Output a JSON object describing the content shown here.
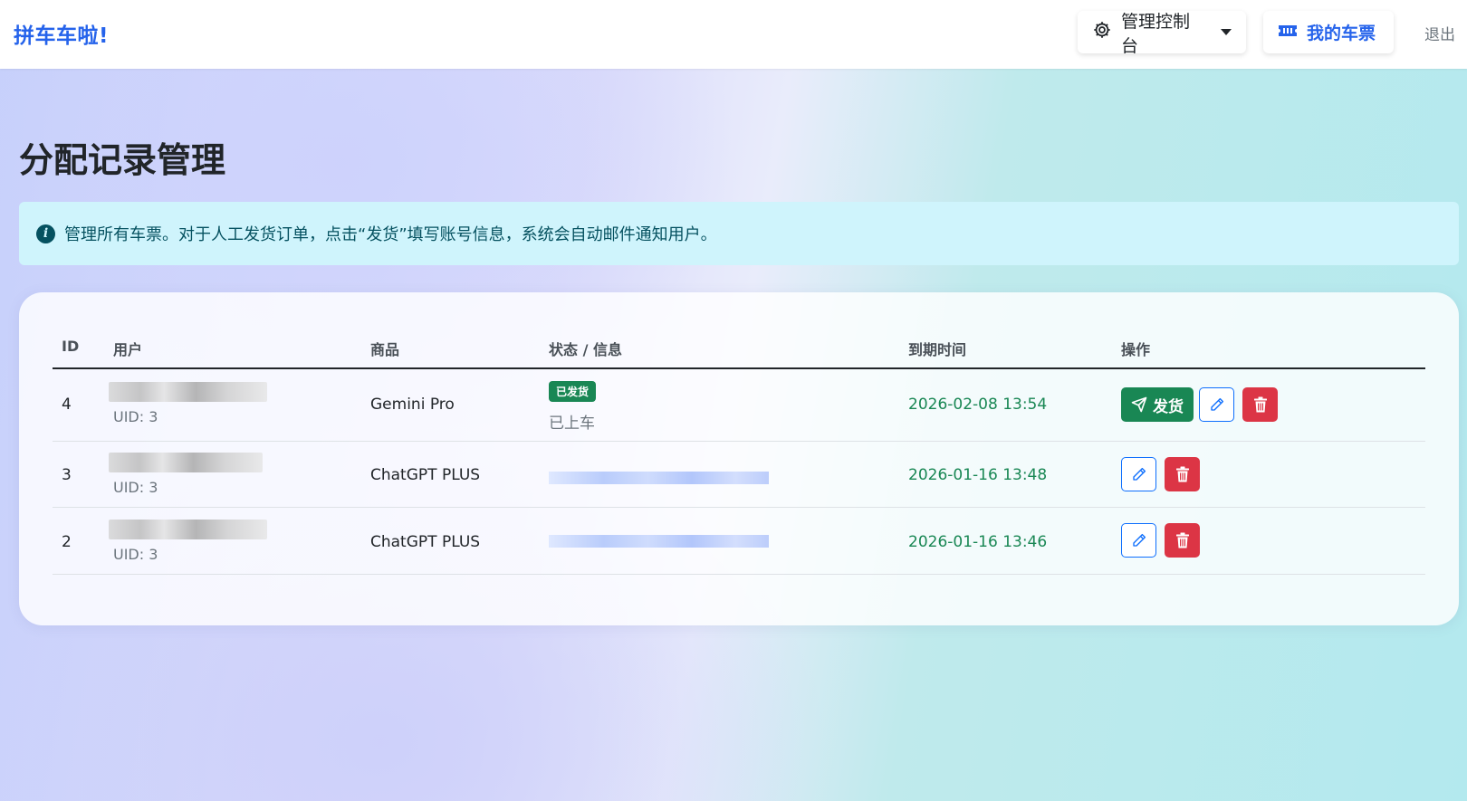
{
  "nav": {
    "brand": "拼车车啦!",
    "admin_label": "管理控制台",
    "tickets_label": "我的车票",
    "logout_label": "退出"
  },
  "page": {
    "title": "分配记录管理",
    "alert": "管理所有车票。对于人工发货订单，点击“发货”填写账号信息，系统会自动邮件通知用户。"
  },
  "table": {
    "headers": {
      "id": "ID",
      "user": "用户",
      "product": "商品",
      "status": "状态 / 信息",
      "expiry": "到期时间",
      "actions": "操作"
    },
    "rows": [
      {
        "id": "4",
        "uid": "UID: 3",
        "product": "Gemini Pro",
        "status_badge": "已发货",
        "status_note": "已上车",
        "expiry": "2026-02-08 13:54",
        "ship_label": "发货"
      },
      {
        "id": "3",
        "uid": "UID: 3",
        "product": "ChatGPT PLUS",
        "expiry": "2026-01-16 13:48"
      },
      {
        "id": "2",
        "uid": "UID: 3",
        "product": "ChatGPT PLUS",
        "expiry": "2026-01-16 13:46"
      }
    ]
  },
  "colors": {
    "brand": "#2563eb",
    "success": "#198754",
    "danger": "#dc3545",
    "primary": "#0d6efd",
    "alert_bg": "#cff4fc"
  },
  "icons": [
    "gear-icon",
    "ticket-icon",
    "info-icon",
    "send-icon",
    "pencil-icon",
    "trash-icon",
    "caret-down-icon"
  ]
}
